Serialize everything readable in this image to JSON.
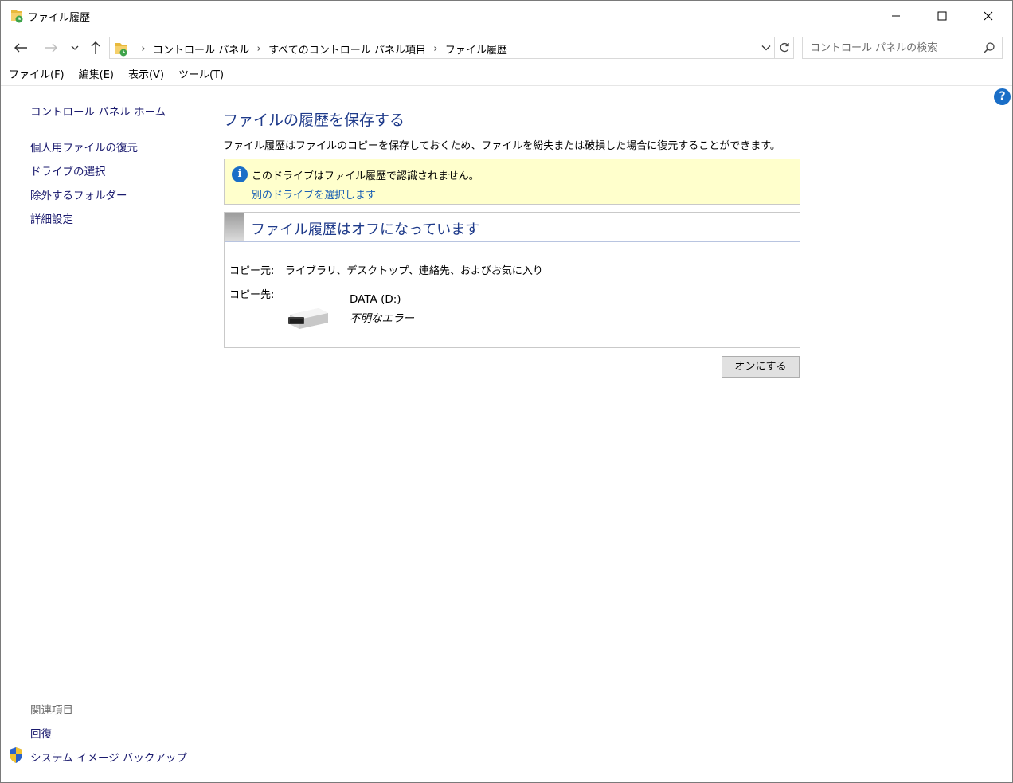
{
  "window": {
    "title": "ファイル履歴"
  },
  "address": {
    "crumbs": [
      "コントロール パネル",
      "すべてのコントロール パネル項目",
      "ファイル履歴"
    ]
  },
  "search": {
    "placeholder": "コントロール パネルの検索"
  },
  "menu": {
    "items": [
      "ファイル(F)",
      "編集(E)",
      "表示(V)",
      "ツール(T)"
    ]
  },
  "help": {
    "label": "?"
  },
  "sidebar": {
    "home": "コントロール パネル ホーム",
    "links": [
      "個人用ファイルの復元",
      "ドライブの選択",
      "除外するフォルダー",
      "詳細設定"
    ],
    "related_title": "関連項目",
    "related": [
      "回復",
      "システム イメージ バックアップ"
    ]
  },
  "main": {
    "title": "ファイルの履歴を保存する",
    "description": "ファイル履歴はファイルのコピーを保存しておくため、ファイルを紛失または破損した場合に復元することができます。",
    "info": {
      "icon": "i",
      "message": "このドライブはファイル履歴で認識されません。",
      "link": "別のドライブを選択します"
    },
    "status": {
      "title": "ファイル履歴はオフになっています",
      "source_label": "コピー元:",
      "source_value": "ライブラリ、デスクトップ、連絡先、およびお気に入り",
      "dest_label": "コピー先:",
      "drive_name": "DATA (D:)",
      "drive_status": "不明なエラー"
    },
    "turn_on_label": "オンにする"
  },
  "colors": {
    "accent_title": "#1e3a8a",
    "link": "#1a5fb4",
    "info_background": "#ffffcc",
    "help_icon": "#1a6ec7"
  },
  "icons": [
    "folder-history-icon",
    "minimize-icon",
    "maximize-icon",
    "close-icon",
    "back-arrow-icon",
    "forward-arrow-icon",
    "chevron-down-icon",
    "up-arrow-icon",
    "refresh-icon",
    "search-icon",
    "help-icon",
    "info-icon",
    "drive-icon",
    "uac-shield-icon"
  ]
}
